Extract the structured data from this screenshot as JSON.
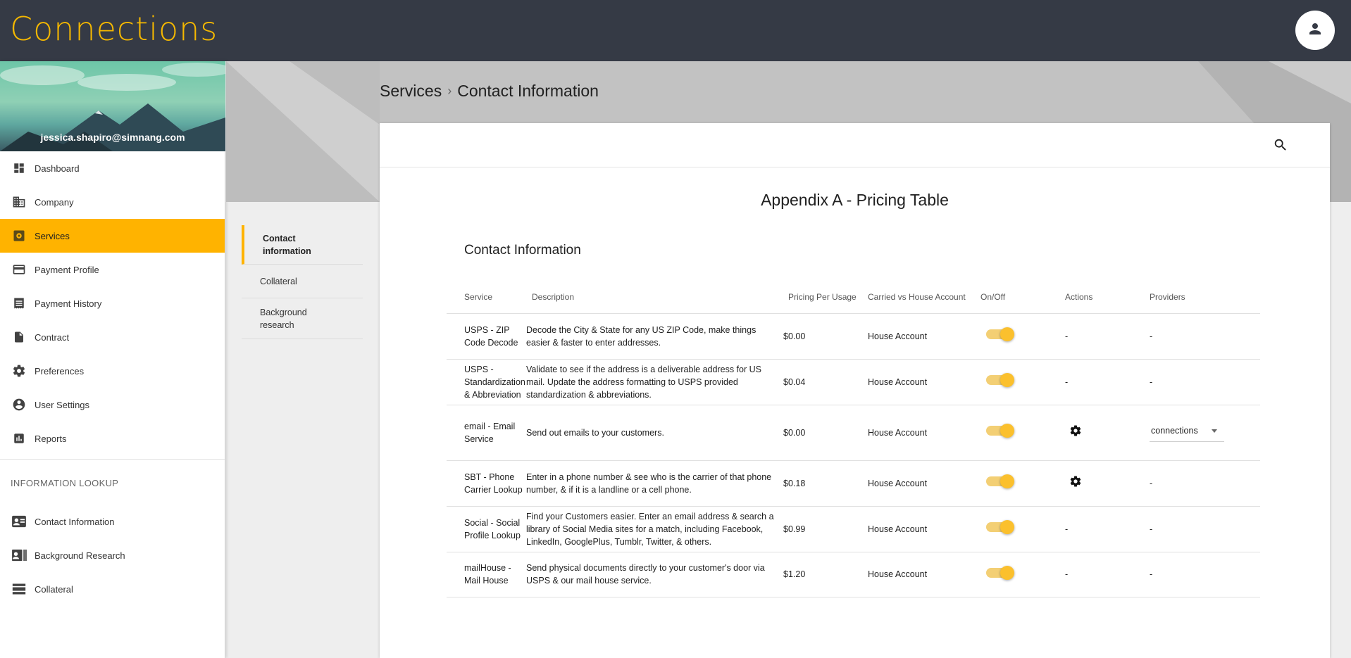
{
  "app": {
    "logo_text": "Connections"
  },
  "user": {
    "email": "jessica.shapiro@simnang.com"
  },
  "sidebar": {
    "items": [
      {
        "label": "Dashboard",
        "icon": "dashboard-icon"
      },
      {
        "label": "Company",
        "icon": "building-icon"
      },
      {
        "label": "Services",
        "icon": "services-icon",
        "active": true
      },
      {
        "label": "Payment Profile",
        "icon": "credit-card-icon"
      },
      {
        "label": "Payment History",
        "icon": "receipt-icon"
      },
      {
        "label": "Contract",
        "icon": "document-icon"
      },
      {
        "label": "Preferences",
        "icon": "gear-icon"
      },
      {
        "label": "User Settings",
        "icon": "account-circle-icon"
      },
      {
        "label": "Reports",
        "icon": "bar-chart-icon"
      }
    ],
    "section_label": "INFORMATION LOOKUP",
    "lookup_items": [
      {
        "label": "Contact Information",
        "icon": "contact-card-icon"
      },
      {
        "label": "Background Research",
        "icon": "background-research-icon"
      },
      {
        "label": "Collateral",
        "icon": "collateral-icon"
      }
    ]
  },
  "breadcrumb": {
    "parent": "Services",
    "current": "Contact Information"
  },
  "subnav": [
    {
      "label": "Contact information",
      "active": true
    },
    {
      "label": "Collateral"
    },
    {
      "label": "Background research"
    }
  ],
  "card": {
    "title": "Appendix A - Pricing Table",
    "section_title": "Contact Information",
    "columns": [
      "Service",
      "Description",
      "Pricing Per Usage",
      "Carried vs House Account",
      "On/Off",
      "Actions",
      "Providers"
    ],
    "rows": [
      {
        "service": "USPS - ZIP Code Decode",
        "description": "Decode the City & State for any US ZIP Code, make things easier & faster to enter addresses.",
        "price": "$0.00",
        "account": "House Account",
        "on": true,
        "actions": "-",
        "providers": "-"
      },
      {
        "service": "USPS - Standardization & Abbreviation",
        "description": "Validate to see if the address is a deliverable address for US mail. Update the address formatting to USPS provided standardization & abbreviations.",
        "price": "$0.04",
        "account": "House Account",
        "on": true,
        "actions": "-",
        "providers": "-"
      },
      {
        "service": "email - Email Service",
        "description": "Send out emails to your customers.",
        "price": "$0.00",
        "account": "House Account",
        "on": true,
        "actions": "gear-icon",
        "providers": "connections",
        "provider_select": true
      },
      {
        "service": "SBT - Phone Carrier Lookup",
        "description": "Enter in a phone number & see who is the carrier of that phone number, & if it is a landline or a cell phone.",
        "price": "$0.18",
        "account": "House Account",
        "on": true,
        "actions": "gear-icon",
        "providers": "-"
      },
      {
        "service": "Social - Social Profile Lookup",
        "description": "Find your Customers easier. Enter an email address & search a library of Social Media sites for a match, including Facebook, LinkedIn, GooglePlus, Tumblr, Twitter, & others.",
        "price": "$0.99",
        "account": "House Account",
        "on": true,
        "actions": "-",
        "providers": "-"
      },
      {
        "service": "mailHouse - Mail House",
        "description": "Send physical documents directly to your customer's door via USPS & our mail house service.",
        "price": "$1.20",
        "account": "House Account",
        "on": true,
        "actions": "-",
        "providers": "-"
      }
    ]
  },
  "colors": {
    "topbar": "#353a45",
    "accent": "#ffb300",
    "logo": "#f5b800",
    "toggle_knob": "#fbc02d",
    "toggle_track": "#f3cf74"
  }
}
